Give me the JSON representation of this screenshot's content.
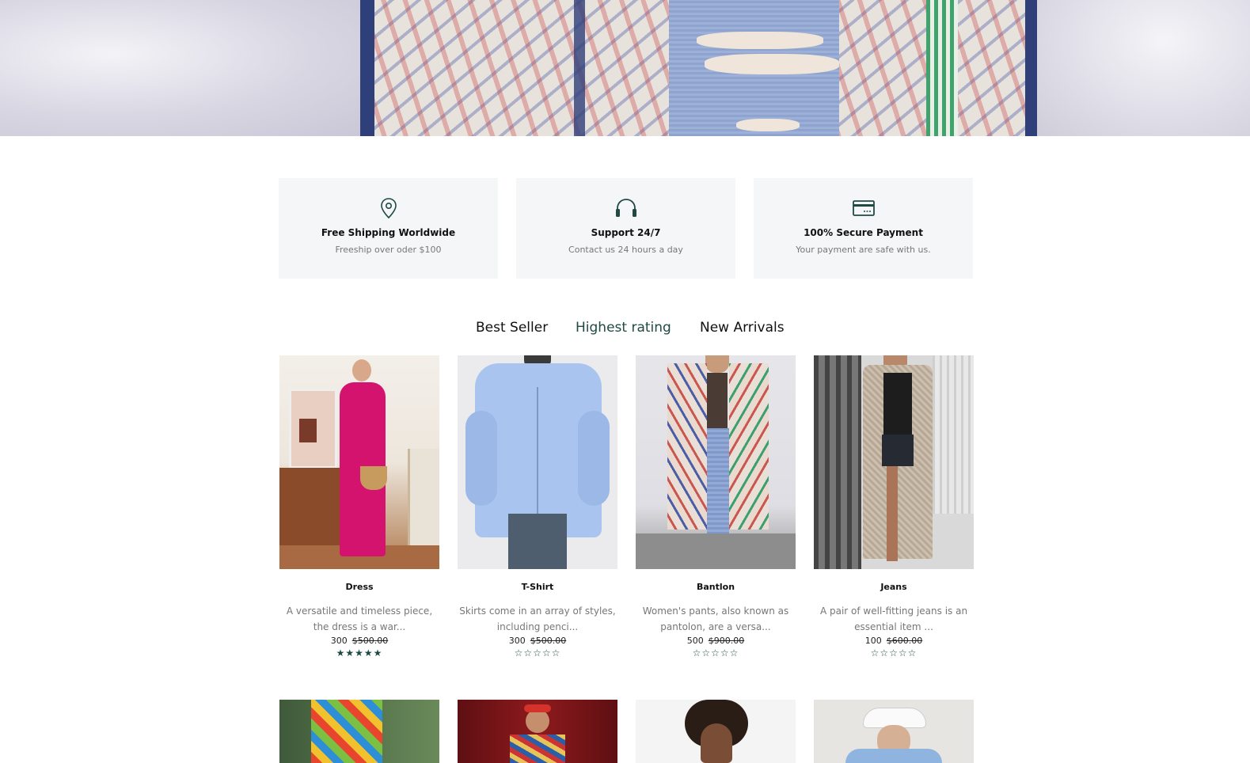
{
  "features": [
    {
      "icon": "location-pin-icon",
      "title": "Free Shipping Worldwide",
      "subtitle": "Freeship over oder $100"
    },
    {
      "icon": "headphones-icon",
      "title": "Support 24/7",
      "subtitle": "Contact us 24 hours a day"
    },
    {
      "icon": "credit-card-icon",
      "title": "100% Secure Payment",
      "subtitle": "Your payment are safe with us."
    }
  ],
  "tabs": {
    "best_seller": "Best Seller",
    "highest_rating": "Highest rating",
    "new_arrivals": "New Arrivals",
    "active": "Highest rating"
  },
  "products": [
    {
      "name": "Dress",
      "description": "A versatile and timeless piece, the dress is a war...",
      "price": "300",
      "old_price": "$500.00",
      "rating": 5,
      "stars": "★★★★★"
    },
    {
      "name": "T-Shirt",
      "description": "Skirts come in an array of styles, including penci...",
      "price": "300",
      "old_price": "$500.00",
      "rating": 0,
      "stars": "☆☆☆☆☆"
    },
    {
      "name": "Bantlon",
      "description": "Women's pants, also known as pantolon, are a versa...",
      "price": "500",
      "old_price": "$900.00",
      "rating": 0,
      "stars": "☆☆☆☆☆"
    },
    {
      "name": "Jeans",
      "description": "A pair of well-fitting jeans is an essential item ...",
      "price": "100",
      "old_price": "$600.00",
      "rating": 0,
      "stars": "☆☆☆☆☆"
    }
  ],
  "colors": {
    "accent": "#1e4a43",
    "feature_bg": "#f4f6f7",
    "muted_text": "#777777"
  }
}
